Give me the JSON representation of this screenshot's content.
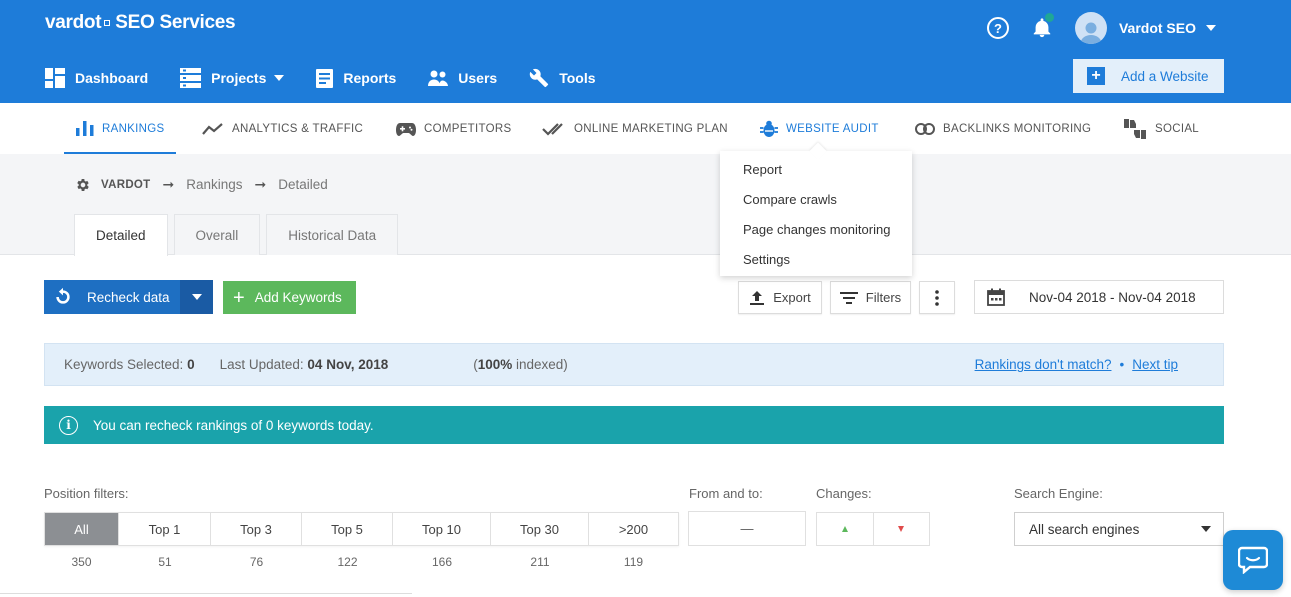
{
  "header": {
    "logo_brand": "vardot",
    "logo_product": "SEO Services",
    "user_name": "Vardot SEO",
    "add_website_label": "Add a Website"
  },
  "main_nav": [
    {
      "label": "Dashboard",
      "icon": "dashboard-icon"
    },
    {
      "label": "Projects",
      "icon": "projects-icon",
      "has_caret": true
    },
    {
      "label": "Reports",
      "icon": "reports-icon"
    },
    {
      "label": "Users",
      "icon": "users-icon"
    },
    {
      "label": "Tools",
      "icon": "wrench-icon"
    }
  ],
  "sub_nav": [
    {
      "label": "RANKINGS",
      "icon": "bar-chart-icon",
      "active": true
    },
    {
      "label": "ANALYTICS & TRAFFIC",
      "icon": "trend-line-icon"
    },
    {
      "label": "COMPETITORS",
      "icon": "gamepad-icon"
    },
    {
      "label": "ONLINE MARKETING PLAN",
      "icon": "double-check-icon"
    },
    {
      "label": "WEBSITE AUDIT",
      "icon": "bug-icon"
    },
    {
      "label": "BACKLINKS MONITORING",
      "icon": "link-icon"
    },
    {
      "label": "SOCIAL",
      "icon": "thumbs-icon"
    }
  ],
  "audit_dropdown": [
    "Report",
    "Compare crawls",
    "Page changes monitoring",
    "Settings"
  ],
  "breadcrumb": {
    "project": "VARDOT",
    "section": "Rankings",
    "page": "Detailed"
  },
  "tabs": [
    "Detailed",
    "Overall",
    "Historical Data"
  ],
  "toolbar": {
    "recheck_label": "Recheck data",
    "add_keywords_label": "Add Keywords",
    "export_label": "Export",
    "filters_label": "Filters",
    "date_range": "Nov-04 2018 - Nov-04 2018"
  },
  "info": {
    "keywords_selected_label": "Keywords Selected:",
    "keywords_selected_value": "0",
    "last_updated_label": "Last Updated:",
    "last_updated_value": "04 Nov, 2018",
    "indexed_value": "100%",
    "indexed_label": " indexed)",
    "link_rankings": "Rankings don't match?",
    "link_next_tip": "Next tip"
  },
  "alert": {
    "message": "You can recheck rankings of 0 keywords today."
  },
  "filters": {
    "position_label": "Position filters:",
    "from_to_label": "From and to:",
    "from_to_value": "—",
    "changes_label": "Changes:",
    "engine_label": "Search Engine:",
    "engine_value": "All search engines",
    "positions": [
      {
        "label": "All",
        "count": "350",
        "active": true
      },
      {
        "label": "Top 1",
        "count": "51"
      },
      {
        "label": "Top 3",
        "count": "76"
      },
      {
        "label": "Top 5",
        "count": "122"
      },
      {
        "label": "Top 10",
        "count": "166"
      },
      {
        "label": "Top 30",
        "count": "211"
      },
      {
        "label": ">200",
        "count": "119"
      }
    ]
  },
  "colors": {
    "primary": "#1e7cd9",
    "success": "#5cb85c",
    "alert": "#1aa3ab"
  }
}
